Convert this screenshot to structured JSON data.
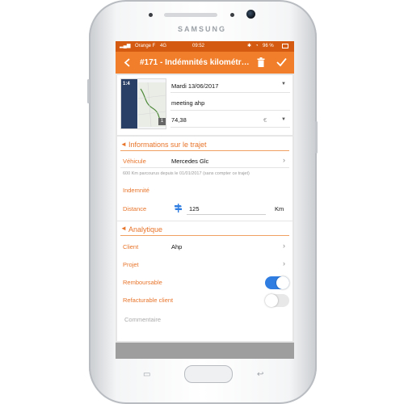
{
  "device": {
    "brand": "SAMSUNG"
  },
  "status_bar": {
    "carrier": "Orange F",
    "network": "4G",
    "time": "09:52",
    "battery": "96 %"
  },
  "app_bar": {
    "title": "#171 - Indémnités kilométr…",
    "accent": "#f07e2a",
    "status_color": "#d35a10"
  },
  "expense": {
    "thumbnail_badge": "1:4",
    "page_indicator": "1",
    "date": "Mardi 13/06/2017",
    "description": "meeting ahp",
    "amount": "74,38",
    "currency": "€"
  },
  "trip": {
    "section_title": "Informations sur le trajet",
    "vehicle_label": "Véhicule",
    "vehicle_value": "Mercedes Glc",
    "mileage_note": "600 Km parcourus depuis le 01/01/2017 (sans compter ce trajet)",
    "indemnity_label": "Indemnité",
    "distance_label": "Distance",
    "distance_value": "125",
    "distance_unit": "Km"
  },
  "analytics": {
    "section_title": "Analytique",
    "client_label": "Client",
    "client_value": "Ahp",
    "project_label": "Projet",
    "reimbursable_label": "Remboursable",
    "reimbursable_on": true,
    "billable_label": "Refacturable client",
    "billable_on": false,
    "comment_placeholder": "Commentaire",
    "toggle_on_color": "#2f7de1"
  },
  "icons": [
    "back-arrow-icon",
    "trash-icon",
    "check-icon",
    "chevron-down-icon",
    "chevron-right-icon",
    "signpost-icon"
  ]
}
